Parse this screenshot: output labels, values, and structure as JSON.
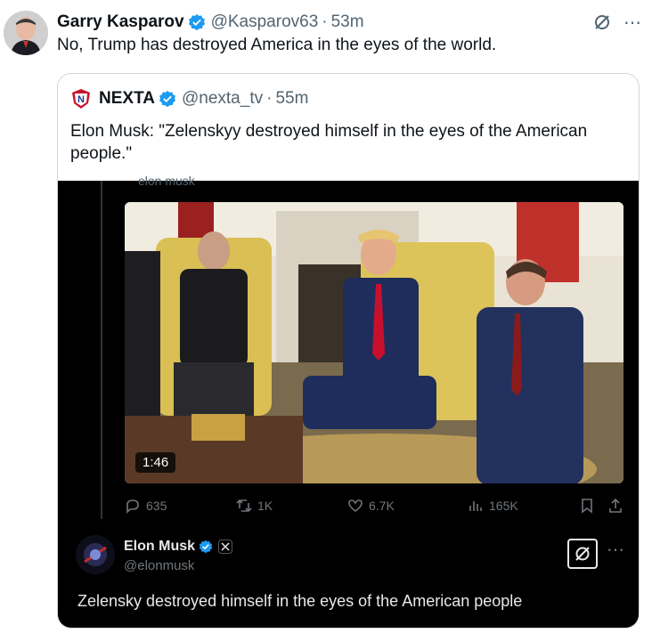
{
  "tweet": {
    "author_name": "Garry Kasparov",
    "handle": "@Kasparov63",
    "sep": "·",
    "time": "53m",
    "text": "No, Trump has destroyed America in the eyes of the world.",
    "more_icon": "more-icon",
    "grok_icon": "grok-icon"
  },
  "quote": {
    "author_name": "NEXTA",
    "handle": "@nexta_tv",
    "sep": "·",
    "time": "55m",
    "text": "Elon Musk: \"Zelenskyy destroyed himself in the eyes of the American people.\"",
    "embedded": {
      "top_partial_text": "elon musk",
      "video_duration": "1:46",
      "reply_count": "635",
      "repost_count": "1K",
      "like_count": "6.7K",
      "view_count": "165K",
      "reply_author": "Elon Musk",
      "reply_handle": "@elonmusk",
      "reply_text": "Zelensky destroyed himself in the eyes of the American people"
    }
  },
  "colors": {
    "verified_blue": "#1d9bf0",
    "muted_gray": "#536471",
    "dark_bg": "#000000"
  }
}
